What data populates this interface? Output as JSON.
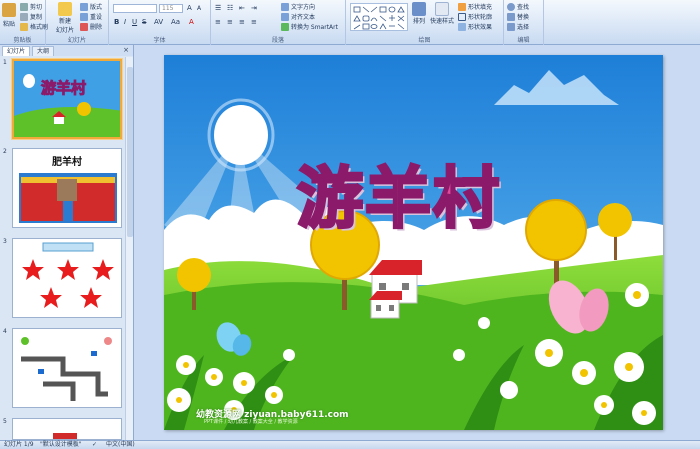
{
  "ribbon": {
    "clipboard": {
      "paste": "粘贴",
      "cut": "剪切",
      "copy": "复制",
      "format": "格式刷",
      "label": "剪贴板"
    },
    "slides": {
      "new": "新建",
      "new2": "幻灯片",
      "layout": "版式",
      "reset": "重设",
      "delete": "删除",
      "label": "幻灯片"
    },
    "font": {
      "size": "115",
      "label": "字体"
    },
    "paragraph": {
      "direction": "文字方向",
      "align": "对齐文本",
      "smartart": "转换为 SmartArt",
      "label": "段落"
    },
    "drawing": {
      "arrange": "排列",
      "quickstyles": "快速样式",
      "fill": "形状填充",
      "outline": "形状轮廓",
      "effects": "形状效果",
      "label": "绘图"
    },
    "editing": {
      "find": "查找",
      "replace": "替换",
      "select": "选择",
      "label": "编辑"
    }
  },
  "panel": {
    "tabs": [
      "幻灯片",
      "大纲"
    ],
    "close": "×",
    "thumbs": [
      {
        "num": "1",
        "title": "游羊村"
      },
      {
        "num": "2",
        "title": "肥羊村"
      },
      {
        "num": "3",
        "title": ""
      },
      {
        "num": "4",
        "title": ""
      },
      {
        "num": "5",
        "title": ""
      }
    ]
  },
  "slide": {
    "title": "游羊村",
    "watermark": "幼教资源网 ziyuan.baby611.com",
    "watermark_sub": "PPT课件 / 幼儿教案 / 教案大全 / 教学资源"
  },
  "status": {
    "slide_count": "幻灯片 1/9",
    "theme": "\"默认设计模板\"",
    "language": "中文(中国)"
  },
  "colors": {
    "sky": "#3fa0e6",
    "grass": "#5fc12a",
    "title_stroke": "#8b1a6a",
    "selection": "#f1a93a"
  }
}
